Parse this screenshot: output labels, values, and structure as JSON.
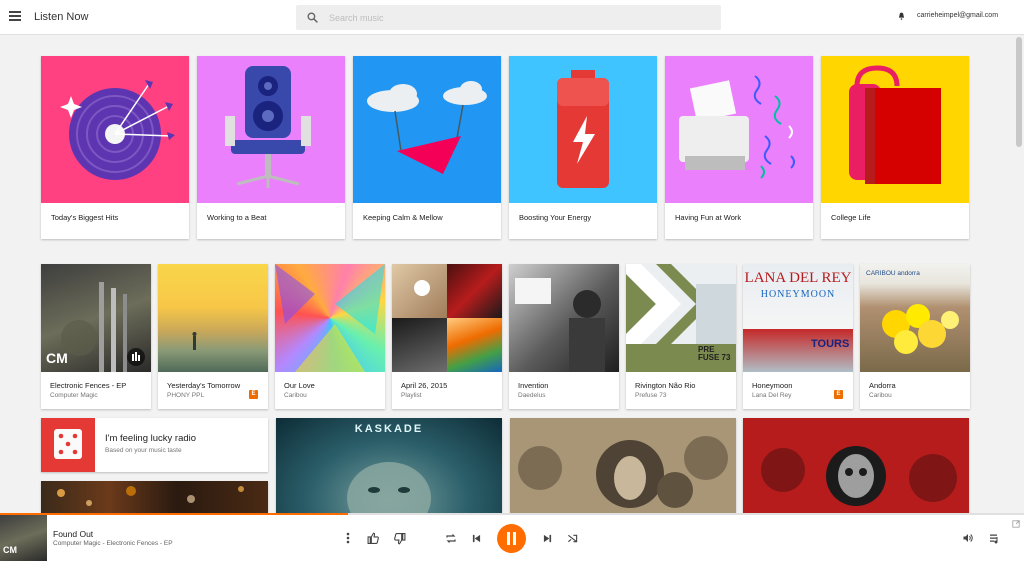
{
  "header": {
    "title": "Listen Now",
    "search_placeholder": "Search music",
    "account_email": "carrieheimpel@gmail.com"
  },
  "situations": [
    {
      "label": "Today's Biggest Hits",
      "color": "#ff4081"
    },
    {
      "label": "Working to a Beat",
      "color": "#ea80fc"
    },
    {
      "label": "Keeping Calm & Mellow",
      "color": "#2196f3"
    },
    {
      "label": "Boosting Your Energy",
      "color": "#40c4ff"
    },
    {
      "label": "Having Fun at Work",
      "color": "#ea80fc"
    },
    {
      "label": "College Life",
      "color": "#ffd600"
    }
  ],
  "albums": [
    {
      "title": "Electronic Fences - EP",
      "artist": "Computer Magic",
      "explicit": false,
      "art_text": "CM"
    },
    {
      "title": "Yesterday's Tomorrow",
      "artist": "PHONY PPL",
      "explicit": true,
      "explicit_label": "E"
    },
    {
      "title": "Our Love",
      "artist": "Caribou",
      "explicit": false
    },
    {
      "title": "April 26, 2015",
      "artist": "Playlist",
      "explicit": false
    },
    {
      "title": "Invention",
      "artist": "Daedelus",
      "explicit": false
    },
    {
      "title": "Rivington Não Rio",
      "artist": "Prefuse 73",
      "explicit": false,
      "art_text": "PRE FUSE 73"
    },
    {
      "title": "Honeymoon",
      "artist": "Lana Del Rey",
      "explicit": true,
      "explicit_label": "E",
      "art_text": "LANA DEL REY",
      "art_text2": "HONEYMOON",
      "art_text3": "TOURS"
    },
    {
      "title": "Andorra",
      "artist": "Caribou",
      "explicit": false,
      "art_text": "CARIBOU andorra"
    }
  ],
  "lucky": {
    "title": "I'm feeling lucky radio",
    "subtitle": "Based on your music taste"
  },
  "featured": {
    "kaskade_label": "KASKADE"
  },
  "player": {
    "track_title": "Found Out",
    "track_subtitle": "Computer Magic - Electronic Fences - EP",
    "art_text": "CM",
    "progress": 0.34
  }
}
